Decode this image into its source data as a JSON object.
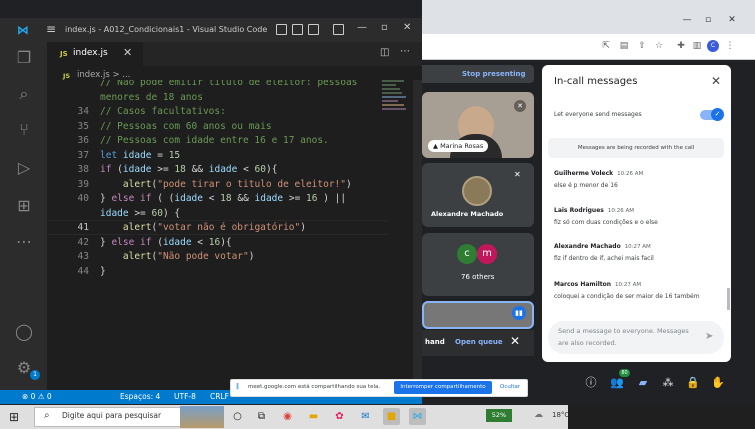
{
  "vscode": {
    "title": "index.js - A012_Condicionais1 - Visual Studio Code",
    "tab_label": "index.js",
    "tab_lang_badge": "JS",
    "breadcrumb": "index.js > ...",
    "code_lines": [
      {
        "num": "",
        "html": "<span class='cm'>// Não pode emitir título de eleitor: pessoas</span>"
      },
      {
        "num": "",
        "html": "<span class='cm'>menores de 18 anos</span>"
      },
      {
        "num": "34",
        "html": "<span class='cm'>// Casos facultativos:</span>"
      },
      {
        "num": "35",
        "html": "<span class='cm'>// Pessoas com 60 anos ou mais</span>"
      },
      {
        "num": "36",
        "html": "<span class='cm'>// Pessoas com idade entre 16 e 17 anos.</span>"
      },
      {
        "num": "37",
        "html": "<span class='kw'>let</span> <span class='vr'>idade</span> = <span class='nm'>15</span>"
      },
      {
        "num": "38",
        "html": "<span class='ctl'>if</span> (<span class='vr'>idade</span> >= <span class='nm'>18</span> && <span class='vr'>idade</span> < <span class='nm'>60</span>){"
      },
      {
        "num": "39",
        "html": "    <span class='fn'>alert</span>(<span class='st'>\"pode tirar o titulo de eleitor!\"</span>)"
      },
      {
        "num": "40",
        "html": "} <span class='ctl'>else if</span> ( (<span class='vr'>idade</span> < <span class='nm'>18</span> && <span class='vr'>idade</span> >= <span class='nm'>16</span> ) ||"
      },
      {
        "num": "",
        "html": "<span class='vr'>idade</span> >= <span class='nm'>60</span>) {"
      },
      {
        "num": "41",
        "html": "    <span class='fn'>alert</span>(<span class='st'>\"votar não é obrigatório\"</span>)",
        "current": true
      },
      {
        "num": "42",
        "html": "} <span class='ctl'>else if</span> (<span class='vr'>idade</span> < <span class='nm'>16</span>){"
      },
      {
        "num": "43",
        "html": "    <span class='fn'>alert</span>(<span class='st'>\"Não pode votar\"</span>)"
      },
      {
        "num": "44",
        "html": "}"
      }
    ],
    "statusbar": {
      "errors": "⊗ 0 ⚠ 0",
      "spaces": "Espaços: 4",
      "encoding": "UTF-8",
      "eol": "CRLF"
    },
    "activity_badge": "1"
  },
  "meet": {
    "stop_presenting": "Stop presenting",
    "tiles": {
      "marina": "Marina Rosas",
      "alexandre": "Alexandre Machado",
      "others_label": "76 others",
      "others_initials": [
        "c",
        "m"
      ]
    },
    "hand_label": "hand",
    "open_queue": "Open queue",
    "share_notice": "meet.google.com está compartilhando sua tela.",
    "share_stop": "Interromper compartilhamento",
    "share_hide": "Ocultar",
    "participants_badge": "80",
    "chat": {
      "title": "In-call messages",
      "let_everyone": "Let everyone send messages",
      "recorded_notice": "Messages are being recorded with the call",
      "messages": [
        {
          "name": "Guilherme Voleck",
          "time": "10:26 AM",
          "text": "else é p menor de 16"
        },
        {
          "name": "Lais Rodrigues",
          "time": "10:26 AM",
          "text": "fiz só com duas condições e o else"
        },
        {
          "name": "Alexandre Machado",
          "time": "10:27 AM",
          "text": "fiz if dentro de if, achei mais facil"
        },
        {
          "name": "Marcos Hamilton",
          "time": "10:27 AM",
          "text": "coloquei a condição de ser maior de 16 também"
        }
      ],
      "send_placeholder": "Send a message to everyone. Messages are also recorded."
    }
  },
  "taskbar": {
    "search_placeholder": "Digite aqui para pesquisar",
    "battery": "52%",
    "temp": "18°C"
  },
  "colors": {
    "vscode_blue": "#007acc",
    "meet_blue": "#1a73e8",
    "accent_link": "#8ab4f8"
  }
}
